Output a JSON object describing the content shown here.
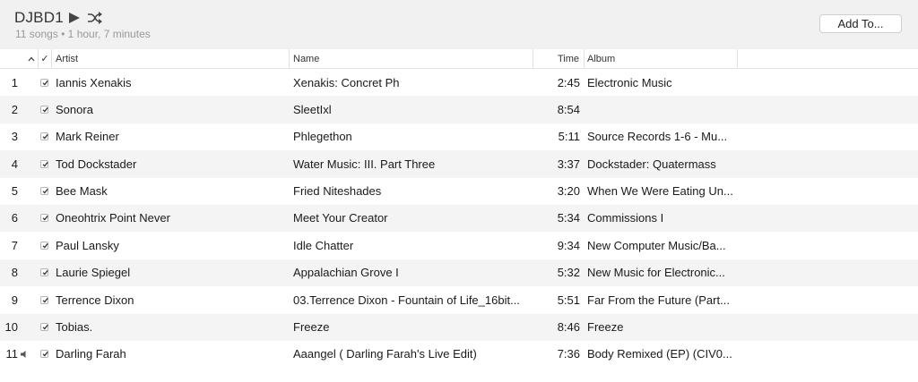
{
  "header": {
    "playlist_title": "DJBD1",
    "summary": "11 songs • 1 hour, 7 minutes",
    "add_to_label": "Add To..."
  },
  "columns": {
    "sort_indicator": "^",
    "check": "✓",
    "artist": "Artist",
    "name": "Name",
    "time": "Time",
    "album": "Album"
  },
  "rows": [
    {
      "num": "1",
      "artist": "Iannis Xenakis",
      "name": "Xenakis: Concret Ph",
      "time": "2:45",
      "album": "Electronic Music",
      "checked": true
    },
    {
      "num": "2",
      "artist": "Sonora",
      "name": "SleetIxl",
      "time": "8:54",
      "album": "",
      "checked": true
    },
    {
      "num": "3",
      "artist": "Mark Reiner",
      "name": "Phlegethon",
      "time": "5:11",
      "album": "Source Records 1-6 - Mu...",
      "checked": true
    },
    {
      "num": "4",
      "artist": "Tod Dockstader",
      "name": "Water Music: III. Part Three",
      "time": "3:37",
      "album": "Dockstader: Quatermass",
      "checked": true
    },
    {
      "num": "5",
      "artist": "Bee Mask",
      "name": "Fried Niteshades",
      "time": "3:20",
      "album": "When We Were Eating Un...",
      "checked": true
    },
    {
      "num": "6",
      "artist": "Oneohtrix Point Never",
      "name": "Meet Your Creator",
      "time": "5:34",
      "album": "Commissions I",
      "checked": true
    },
    {
      "num": "7",
      "artist": "Paul Lansky",
      "name": "Idle Chatter",
      "time": "9:34",
      "album": "New Computer Music/Ba...",
      "checked": true
    },
    {
      "num": "8",
      "artist": "Laurie Spiegel",
      "name": "Appalachian Grove I",
      "time": "5:32",
      "album": "New Music for Electronic...",
      "checked": true
    },
    {
      "num": "9",
      "artist": "Terrence Dixon",
      "name": "03.Terrence Dixon - Fountain of Life_16bit...",
      "time": "5:51",
      "album": "Far From the Future (Part...",
      "checked": true
    },
    {
      "num": "10",
      "artist": "Tobias.",
      "name": "Freeze",
      "time": "8:46",
      "album": "Freeze",
      "checked": true
    },
    {
      "num": "11",
      "artist": "Darling Farah",
      "name": "Aaangel ( Darling Farah's Live Edit)",
      "time": "7:36",
      "album": "Body Remixed (EP) (CIV0...",
      "checked": true,
      "playing": true
    }
  ]
}
